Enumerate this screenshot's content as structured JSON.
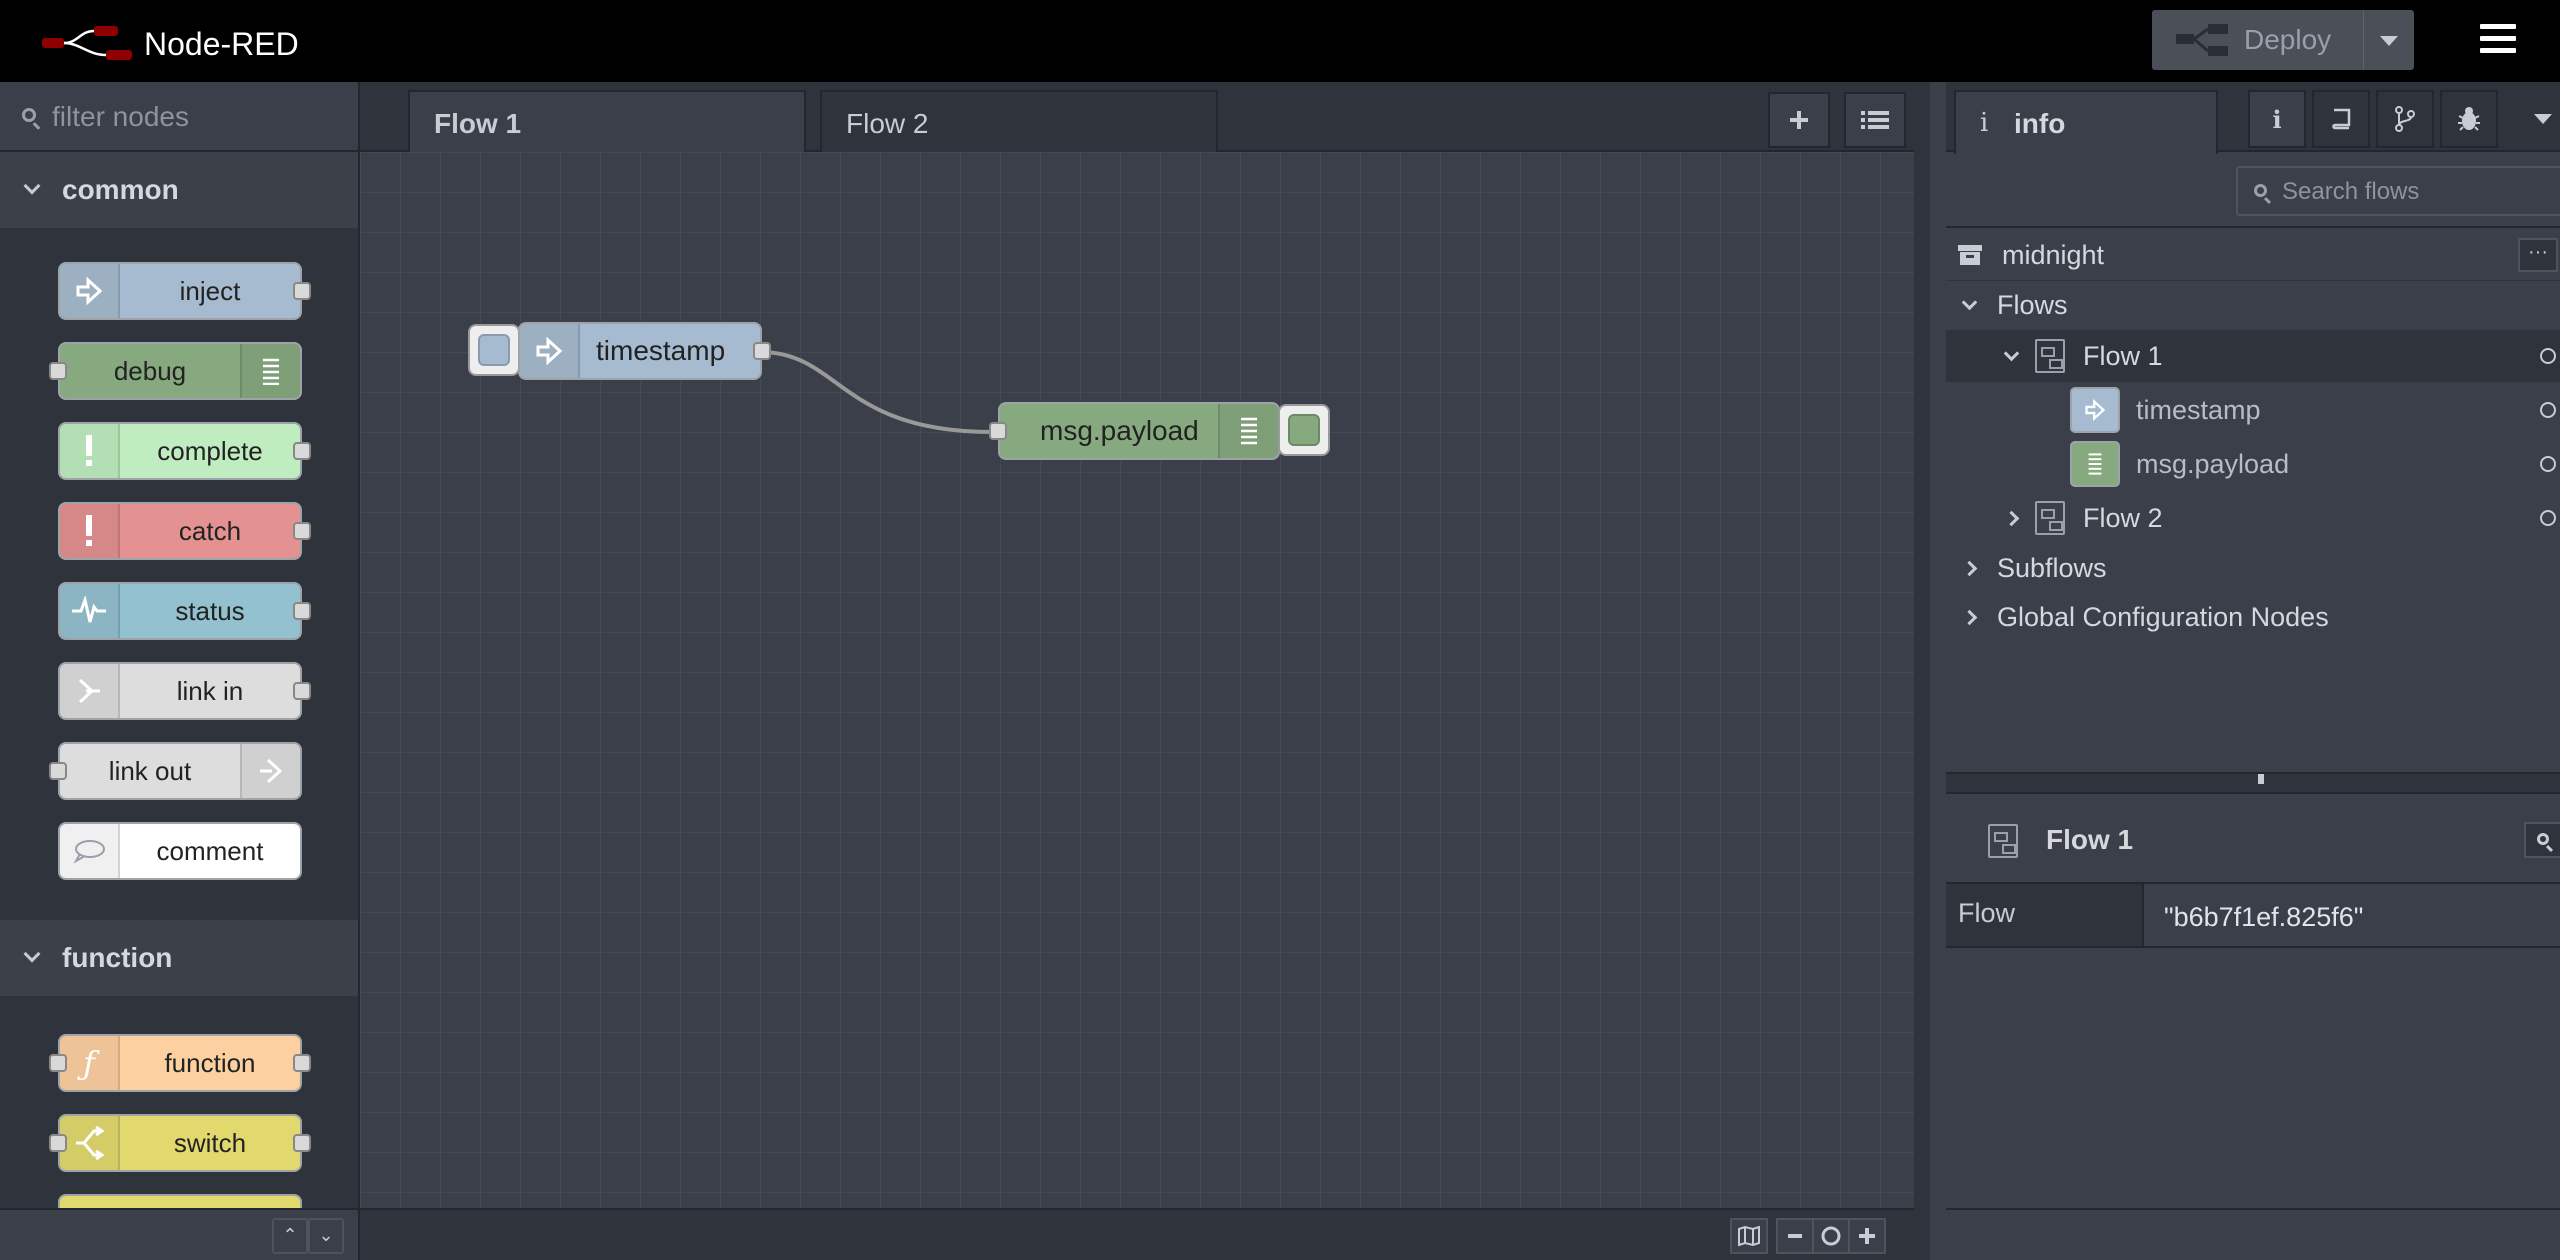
{
  "header": {
    "app_title": "Node-RED",
    "deploy_label": "Deploy"
  },
  "palette": {
    "filter_placeholder": "filter nodes",
    "categories": [
      {
        "label": "common",
        "nodes": [
          {
            "label": "inject",
            "color": "#a6bbcf"
          },
          {
            "label": "debug",
            "color": "#87a980"
          },
          {
            "label": "complete",
            "color": "#c0edc0"
          },
          {
            "label": "catch",
            "color": "#e49191"
          },
          {
            "label": "status",
            "color": "#94c1d0"
          },
          {
            "label": "link in",
            "color": "#dddddd"
          },
          {
            "label": "link out",
            "color": "#dddddd"
          },
          {
            "label": "comment",
            "color": "#ffffff"
          }
        ]
      },
      {
        "label": "function",
        "nodes": [
          {
            "label": "function",
            "color": "#fdd0a2"
          },
          {
            "label": "switch",
            "color": "#e2d96e"
          }
        ]
      }
    ]
  },
  "workspace": {
    "tabs": [
      {
        "label": "Flow 1",
        "active": true
      },
      {
        "label": "Flow 2",
        "active": false
      }
    ],
    "nodes": [
      {
        "label": "timestamp",
        "type": "inject",
        "color": "#a6bbcf"
      },
      {
        "label": "msg.payload",
        "type": "debug",
        "color": "#87a980"
      }
    ]
  },
  "sidebar": {
    "tab_label": "info",
    "search_placeholder": "Search flows",
    "project": "midnight",
    "tree": {
      "flows_label": "Flows",
      "flow1": "Flow 1",
      "flow1_children": [
        "timestamp",
        "msg.payload"
      ],
      "flow2": "Flow 2",
      "subflows": "Subflows",
      "global_config": "Global Configuration Nodes"
    },
    "properties": {
      "title": "Flow 1",
      "key": "Flow",
      "value": "\"b6b7f1ef.825f6\""
    }
  }
}
